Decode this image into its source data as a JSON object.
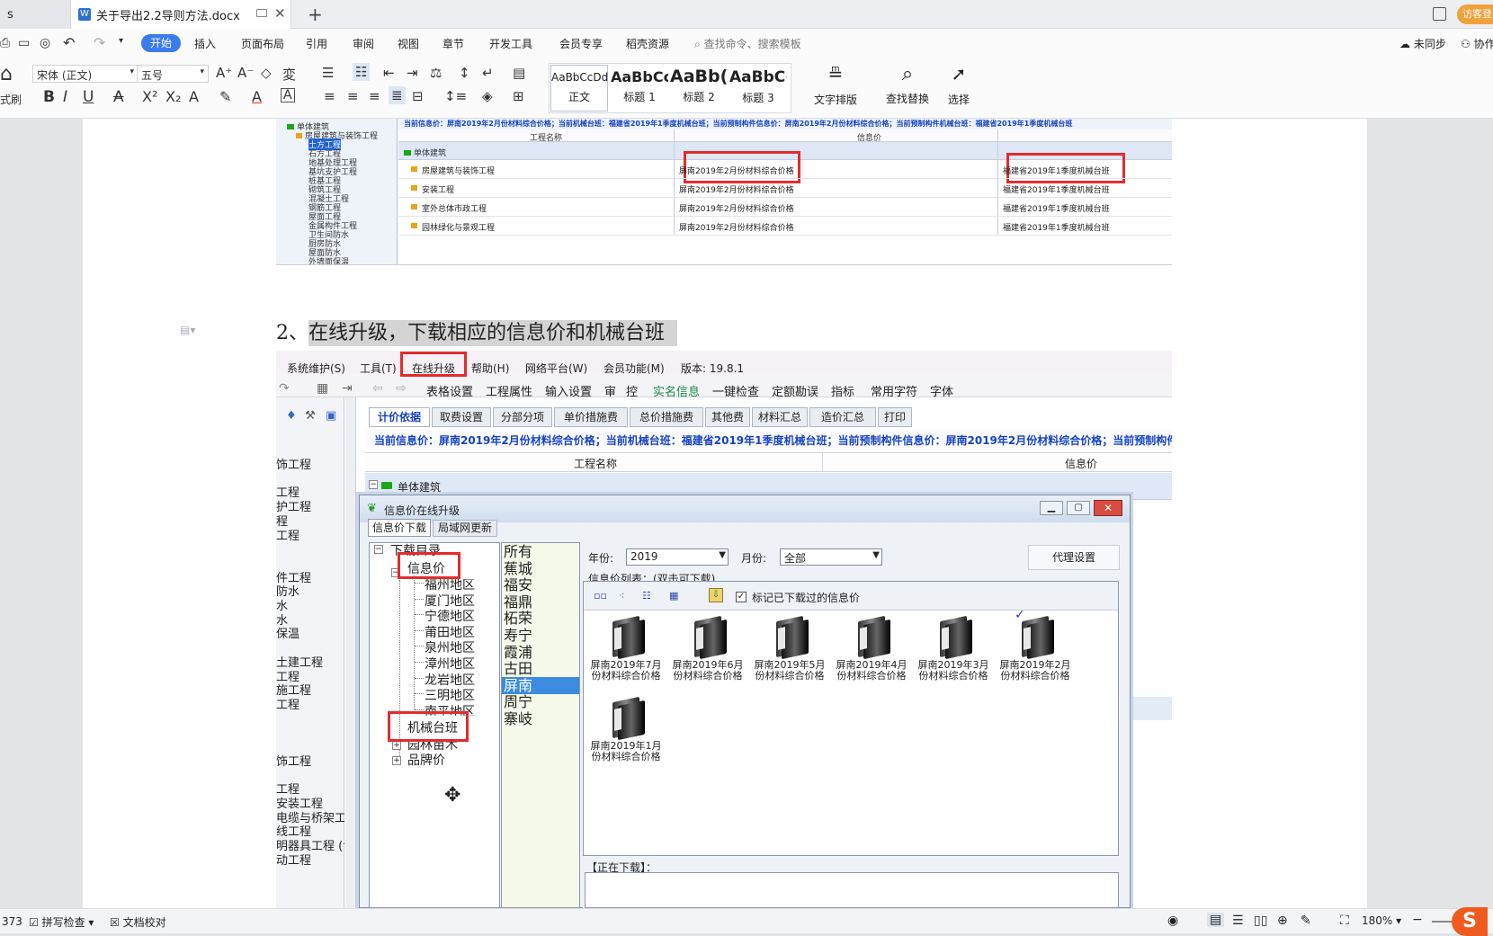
{
  "tabs": [
    {
      "label": "s"
    },
    {
      "label": "关于导出2.2导则方法.docx"
    }
  ],
  "tab_add": "+",
  "guest": "访客登",
  "ribbon": {
    "menus": [
      "开始",
      "插入",
      "页面布局",
      "引用",
      "审阅",
      "视图",
      "章节",
      "开发工具",
      "会员专享",
      "稻壳资源"
    ],
    "search": "查找命令、搜索模板",
    "sync": "未同步",
    "collab": "协作",
    "font_name": "宋体 (正文)",
    "font_size": "五号",
    "format_painter": "式刷",
    "styles": [
      {
        "preview": "AaBbCcDd",
        "name": "正文"
      },
      {
        "preview": "AaBbCcl",
        "name": "标题 1"
      },
      {
        "preview": "AaBb(",
        "name": "标题 2"
      },
      {
        "preview": "AaBbC(",
        "name": "标题 3"
      }
    ],
    "text_layout": "文字排版",
    "find_replace": "查找替换",
    "select": "选择"
  },
  "top_shot": {
    "info_bar": "当前信息价：屏南2019年2月份材料综合价格；当前机械台班：福建省2019年1季度机械台班；当前预制构件信息价：屏南2019年2月份材料综合价格；当前预制构件机械台班：福建省2019年1季度机械台班",
    "col_project": "工程名称",
    "col_info": "信息价",
    "tree": [
      "单体建筑",
      "房屋建筑与装饰工程",
      "土方工程",
      "石方工程",
      "地基处理工程",
      "基坑支护工程",
      "桩基工程",
      "砌筑工程",
      "混凝土工程",
      "钢筋工程",
      "屋面工程",
      "金属构件工程",
      "卫生间防水",
      "厨房防水",
      "屋面防水",
      "外墙面保温"
    ],
    "group": "单体建筑",
    "rows": [
      {
        "name": "房屋建筑与装饰工程",
        "info": "屏南2019年2月份材料综合价格",
        "mach": "福建省2019年1季度机械台班"
      },
      {
        "name": "安装工程",
        "info": "屏南2019年2月份材料综合价格",
        "mach": "福建省2019年1季度机械台班"
      },
      {
        "name": "室外总体市政工程",
        "info": "屏南2019年2月份材料综合价格",
        "mach": "福建省2019年1季度机械台班"
      },
      {
        "name": "园林绿化与景观工程",
        "info": "屏南2019年2月份材料综合价格",
        "mach": "福建省2019年1季度机械台班"
      }
    ]
  },
  "heading": {
    "num": "2、",
    "text": "在线升级，下载相应的信息价和机械台班"
  },
  "app": {
    "menus": [
      "系统维护(S)",
      "工具(T)",
      "在线升级",
      "帮助(H)",
      "网络平台(W)",
      "会员功能(M)",
      "版本: 19.8.1"
    ],
    "toolbar": [
      "表格设置",
      "工程属性",
      "输入设置",
      "审",
      "控",
      "实名信息",
      "一键检查",
      "定额勘误",
      "指标",
      "常用字符",
      "字体"
    ],
    "tabs": [
      "计价依据",
      "取费设置",
      "分部分项",
      "单价措施费",
      "总价措施费",
      "其他费",
      "材料汇总",
      "造价汇总",
      "打印"
    ],
    "info_bar": "当前信息价：屏南2019年2月份材料综合价格；当前机械台班：福建省2019年1季度机械台班；当前预制构件信息价：屏南2019年2月份材料综合价格；当前预制构件机械台班",
    "col_project": "工程名称",
    "col_info": "信息价",
    "group": "单体建筑",
    "left_tree": [
      "饰工程",
      "",
      "工程",
      "护工程",
      "程",
      "工程",
      "",
      "",
      "件工程",
      "防水",
      "水",
      "水",
      "保温",
      "",
      "土建工程",
      "工程",
      "施工程",
      "工程",
      "",
      "",
      "",
      "饰工程",
      "",
      "工程",
      "安装工程",
      "电缆与桥架工",
      "线工程",
      "明器具工程 (含",
      "动工程"
    ]
  },
  "dialog": {
    "title": "信息价在线升级",
    "tabs": [
      "信息价下载",
      "局域网更新"
    ],
    "tree_root": "下载目录",
    "tree_info": "信息价",
    "regions": [
      "福州地区",
      "厦门地区",
      "宁德地区",
      "莆田地区",
      "泉州地区",
      "漳州地区",
      "龙岩地区",
      "三明地区",
      "南平地区"
    ],
    "tree_machine": "机械台班",
    "tree_garden": "园林苗木",
    "tree_brand": "品牌价",
    "cities": [
      "所有",
      "蕉城",
      "福安",
      "福鼎",
      "柘荣",
      "寿宁",
      "霞浦",
      "古田",
      "屏南",
      "周宁",
      "寨岐"
    ],
    "selected_city": "屏南",
    "year_label": "年份:",
    "year_value": "2019",
    "month_label": "月份:",
    "month_value": "全部",
    "proxy": "代理设置",
    "list_label": "信息价列表：(双击可下载)",
    "mark_downloaded": "标记已下载过的信息价",
    "items": [
      {
        "l1": "屏南2019年7月",
        "l2": "份材料综合价格"
      },
      {
        "l1": "屏南2019年6月",
        "l2": "份材料综合价格"
      },
      {
        "l1": "屏南2019年5月",
        "l2": "份材料综合价格"
      },
      {
        "l1": "屏南2019年4月",
        "l2": "份材料综合价格"
      },
      {
        "l1": "屏南2019年3月",
        "l2": "份材料综合价格"
      },
      {
        "l1": "屏南2019年2月",
        "l2": "份材料综合价格"
      },
      {
        "l1": "屏南2019年1月",
        "l2": "份材料综合价格"
      }
    ],
    "downloading": "【正在下载】："
  },
  "status": {
    "page": "373",
    "spell": "拼写检查",
    "proof": "文档校对",
    "zoom": "180%"
  }
}
